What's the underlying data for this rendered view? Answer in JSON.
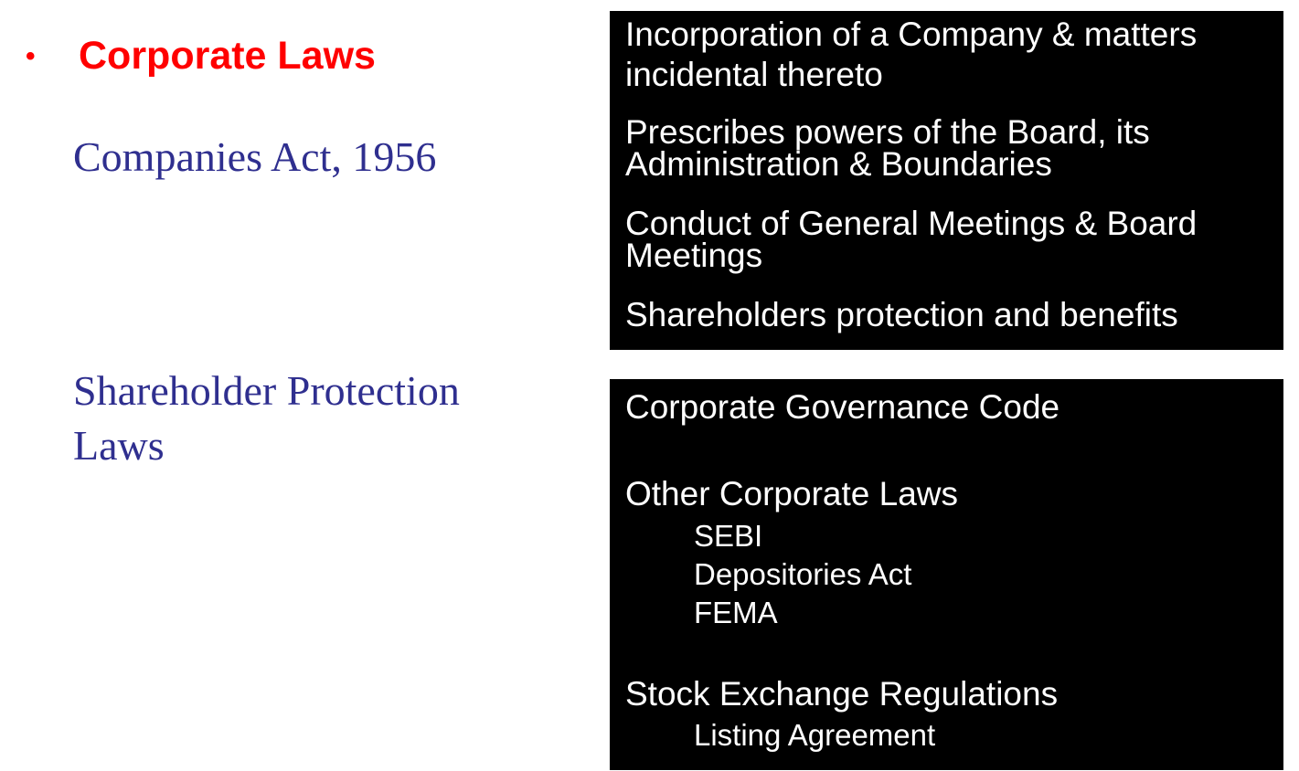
{
  "section": {
    "bullet": "•",
    "heading": "Corporate Laws"
  },
  "left": {
    "label1": "Companies Act, 1956",
    "label2_line1": "Shareholder Protection",
    "label2_line2": "Laws"
  },
  "box1": {
    "item1_line1": "Incorporation of a Company & matters",
    "item1_line2": "incidental thereto",
    "item2_line1": "Prescribes powers of the Board, its",
    "item2_line2": "Administration & Boundaries",
    "item3_line1": "Conduct of General Meetings & Board",
    "item3_line2": "Meetings",
    "item4": "Shareholders protection and benefits"
  },
  "box2": {
    "item1": "Corporate Governance Code",
    "item2": "Other Corporate Laws",
    "item2_subs": [
      "SEBI",
      "Depositories Act",
      "FEMA"
    ],
    "item3": "Stock Exchange Regulations",
    "item3_sub": "Listing Agreement"
  },
  "colors": {
    "heading": "#ff0000",
    "label": "#2f2f8f",
    "box_bg": "#000000",
    "box_text": "#ffffff"
  }
}
